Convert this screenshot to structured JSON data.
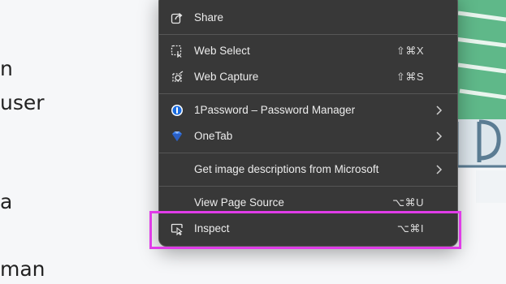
{
  "background_text": [
    "n",
    "user",
    "a",
    "man"
  ],
  "menu": {
    "items": [
      {
        "label": "Share",
        "shortcut": "",
        "icon": "share-icon"
      },
      {
        "label": "Web Select",
        "shortcut": "⇧⌘X",
        "icon": "web-select-icon"
      },
      {
        "label": "Web Capture",
        "shortcut": "⇧⌘S",
        "icon": "web-capture-icon"
      },
      {
        "label": "1Password – Password Manager",
        "shortcut": "",
        "icon": "1password-icon",
        "submenu": true
      },
      {
        "label": "OneTab",
        "shortcut": "",
        "icon": "onetab-icon",
        "submenu": true
      },
      {
        "label": "Get image descriptions from Microsoft",
        "shortcut": "",
        "icon": "",
        "submenu": true
      },
      {
        "label": "View Page Source",
        "shortcut": "⌥⌘U",
        "icon": ""
      },
      {
        "label": "Inspect",
        "shortcut": "⌥⌘I",
        "icon": "inspect-icon"
      }
    ]
  },
  "colors": {
    "menu_background": "#383838",
    "highlight": "#e03ce8",
    "illustration_green": "#5fb889"
  }
}
